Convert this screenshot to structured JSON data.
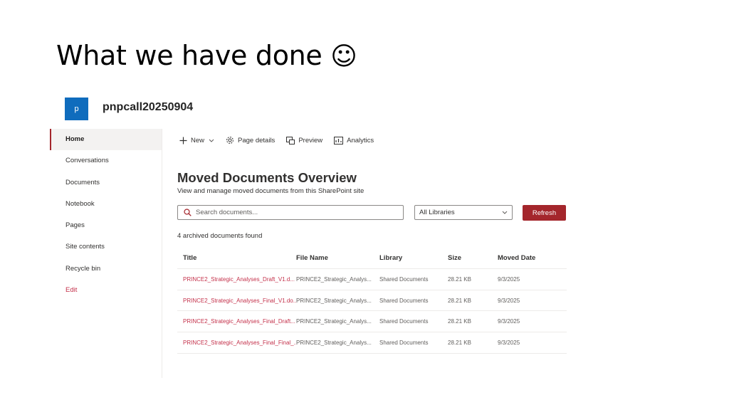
{
  "slide": {
    "title": "What we have done",
    "emoji": "☺"
  },
  "site": {
    "logo_letter": "p",
    "name": "pnpcall20250904"
  },
  "nav": {
    "items": [
      {
        "label": "Home",
        "active": true
      },
      {
        "label": "Conversations"
      },
      {
        "label": "Documents"
      },
      {
        "label": "Notebook"
      },
      {
        "label": "Pages"
      },
      {
        "label": "Site contents"
      },
      {
        "label": "Recycle bin"
      },
      {
        "label": "Edit"
      }
    ]
  },
  "commandbar": {
    "new_label": "New",
    "page_details_label": "Page details",
    "preview_label": "Preview",
    "analytics_label": "Analytics"
  },
  "page": {
    "heading": "Moved Documents Overview",
    "subtitle": "View and manage moved documents from this SharePoint site",
    "search_placeholder": "Search documents...",
    "library_filter_value": "All Libraries",
    "refresh_label": "Refresh",
    "count_text": "4 archived documents found"
  },
  "table": {
    "columns": [
      "Title",
      "File Name",
      "Library",
      "Size",
      "Moved Date"
    ],
    "rows": [
      [
        "PRINCE2_Strategic_Analyses_Draft_V1.d...",
        "PRINCE2_Strategic_Analys...",
        "Shared Documents",
        "28.21 KB",
        "9/3/2025"
      ],
      [
        "PRINCE2_Strategic_Analyses_Final_V1.do...",
        "PRINCE2_Strategic_Analys...",
        "Shared Documents",
        "28.21 KB",
        "9/3/2025"
      ],
      [
        "PRINCE2_Strategic_Analyses_Final_Draft...",
        "PRINCE2_Strategic_Analys...",
        "Shared Documents",
        "28.21 KB",
        "9/3/2025"
      ],
      [
        "PRINCE2_Strategic_Analyses_Final_Final_...",
        "PRINCE2_Strategic_Analys...",
        "Shared Documents",
        "28.21 KB",
        "9/3/2025"
      ]
    ]
  },
  "colors": {
    "accent": "#a4262c",
    "link": "#c4314b",
    "logo_bg": "#0f6cbd"
  },
  "icons": {
    "new": "plus-icon",
    "new_dropdown": "chevron-down-icon",
    "page_details": "gear-icon",
    "preview": "preview-icon",
    "analytics": "analytics-icon",
    "search": "search-icon",
    "library_dropdown": "chevron-down-icon"
  }
}
